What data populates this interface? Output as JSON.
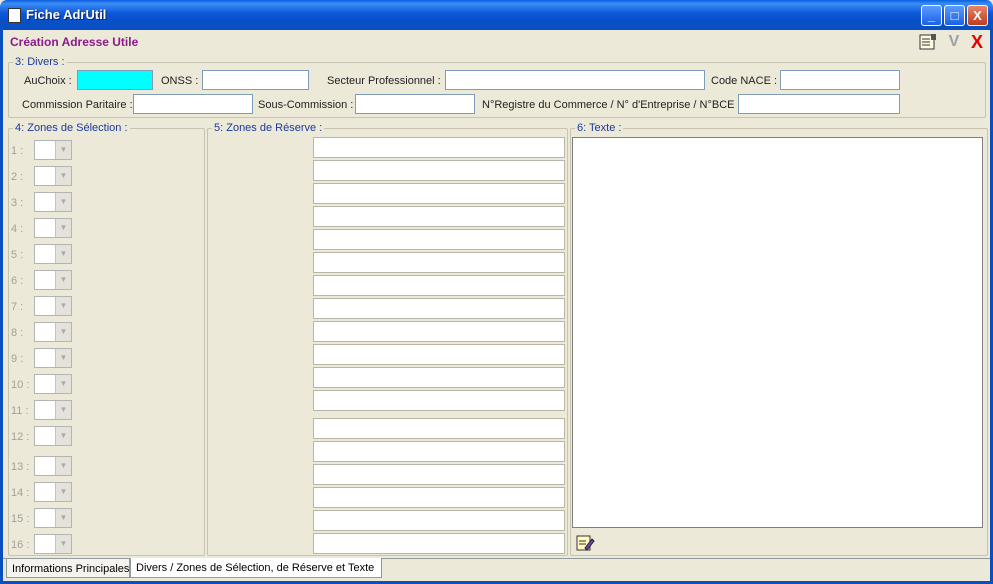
{
  "window": {
    "title": "Fiche AdrUtil",
    "min_glyph": "_",
    "max_glyph": "□",
    "close_glyph": "X"
  },
  "header": {
    "form_title": "Création Adresse Utile",
    "note_icon": "note-icon",
    "validate_glyph": "V",
    "cancel_glyph": "X"
  },
  "divers": {
    "legend": "3: Divers :",
    "auchoix_label": "AuChoix :",
    "onss_label": "ONSS :",
    "secteur_label": "Secteur Professionnel :",
    "nace_label": "Code NACE :",
    "commission_label": "Commission Paritaire :",
    "souscommission_label": "Sous-Commission :",
    "registre_label": "N°Registre du Commerce / N° d'Entreprise / N°BCE :"
  },
  "selection": {
    "legend": "4: Zones de Sélection :",
    "items": [
      "1 :",
      "2 :",
      "3 :",
      "4 :",
      "5 :",
      "6 :",
      "7 :",
      "8 :",
      "9 :",
      "10 :",
      "11 :",
      "12 :",
      "13 :",
      "14 :",
      "15 :",
      "16 :"
    ],
    "arrow_glyph": "▼"
  },
  "reserve": {
    "legend": "5: Zones de Réserve :"
  },
  "texte": {
    "legend": "6: Texte :",
    "edit_icon": "pencil-note-icon"
  },
  "tabs": [
    {
      "label": "Informations Principales"
    },
    {
      "label": "Divers / Zones de Sélection, de Réserve et Texte"
    }
  ],
  "colors": {
    "title_accent": "#8b1a89",
    "legend_text": "#1a3a9c",
    "active_field": "#00ffff",
    "titlebar": "#0a5fe0"
  }
}
